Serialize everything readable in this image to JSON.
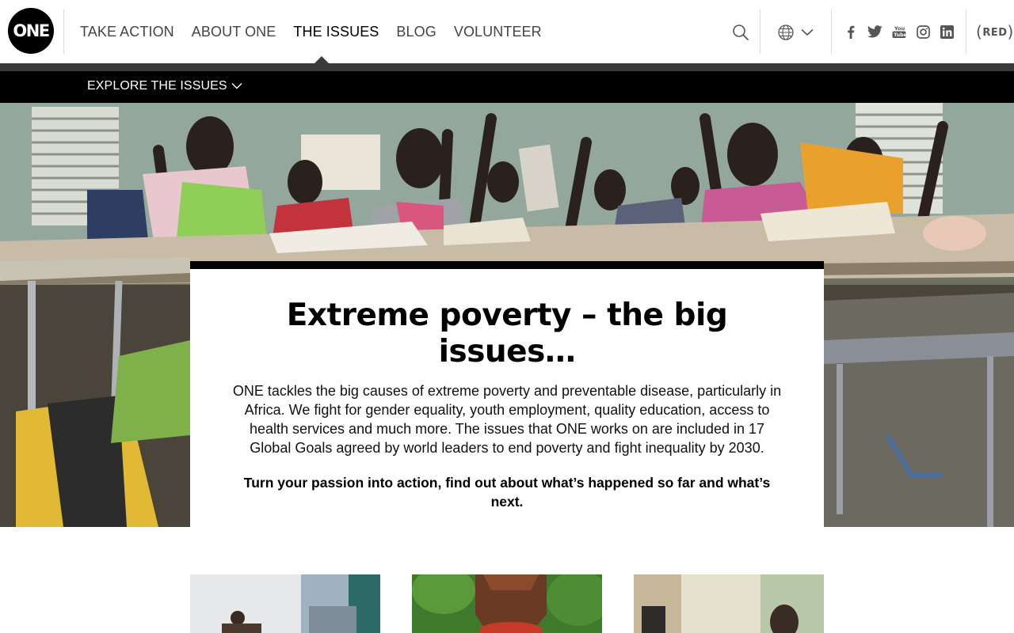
{
  "header": {
    "logo_text": "ONE",
    "nav": [
      {
        "label": "TAKE ACTION",
        "active": false
      },
      {
        "label": "ABOUT ONE",
        "active": false
      },
      {
        "label": "THE ISSUES",
        "active": true
      },
      {
        "label": "BLOG",
        "active": false
      },
      {
        "label": "VOLUNTEER",
        "active": false
      }
    ],
    "icons": [
      "search-icon",
      "globe-icon",
      "chevron-down-icon",
      "facebook-icon",
      "twitter-icon",
      "youtube-icon",
      "instagram-icon",
      "linkedin-icon"
    ],
    "red_logo": {
      "open": "(",
      "text": "RED",
      "close": ")"
    }
  },
  "subnav": {
    "label": "EXPLORE THE ISSUES",
    "icon": "chevron-down-icon"
  },
  "hero": {
    "title": "Extreme poverty – the big issues…",
    "body": "ONE tackles the big causes of extreme poverty and preventable disease, particularly in Africa. We fight for gender equality, youth employment, quality education, access to health services and much more. The issues that ONE works on are included in 17 Global Goals agreed by world leaders to end poverty and fight inequality by 2030.",
    "cta": "Turn your passion into action, find out about what’s happened so far and what’s next."
  },
  "colors": {
    "black": "#000000",
    "header_band": "#3a3a3a",
    "nav_text": "#444444"
  }
}
